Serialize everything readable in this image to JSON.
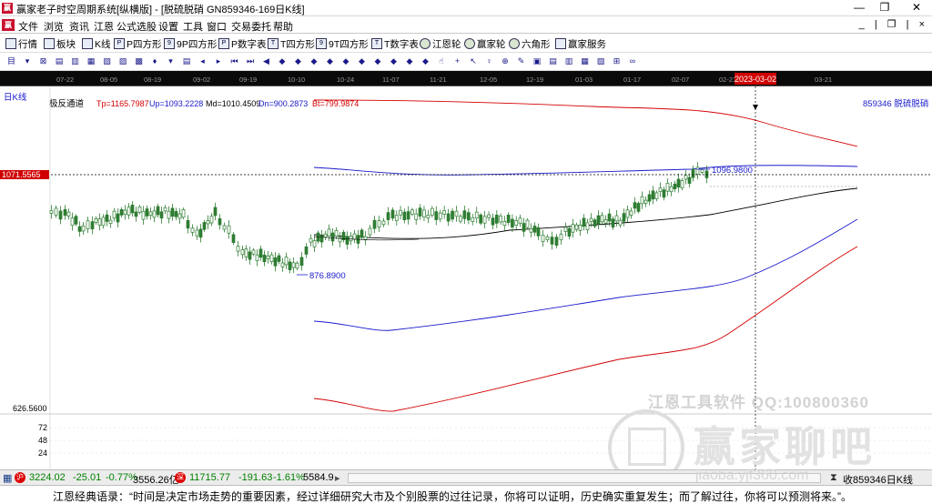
{
  "window": {
    "title": "赢家老子时空周期系统[纵横版] - [脱硫脱硝  GN859346-169日K线]",
    "minimize_glyph": "—",
    "maximize_glyph": "❐",
    "close_glyph": "✕"
  },
  "menu": {
    "items": [
      "文件",
      "浏览",
      "资讯",
      "江恩",
      "公式选股",
      "设置",
      "工具",
      "窗口",
      "交易委托",
      "帮助"
    ],
    "mdi_controls": "_ | ❐ | ×"
  },
  "toolbar1": {
    "items": [
      {
        "label": "行情",
        "icon": "grid-icon"
      },
      {
        "label": "板块",
        "icon": "blocks-icon"
      },
      {
        "label": "K线",
        "icon": "candle-icon"
      },
      {
        "label": "P四方形",
        "icon": "square-p-icon"
      },
      {
        "label": "9P四方形",
        "icon": "square-9p-icon"
      },
      {
        "label": "P数字表",
        "icon": "table-p-icon"
      },
      {
        "label": "T四方形",
        "icon": "square-t-icon"
      },
      {
        "label": "9T四方形",
        "icon": "square-9t-icon"
      },
      {
        "label": "T数字表",
        "icon": "table-t-icon"
      },
      {
        "label": "江恩轮",
        "icon": "wheel-icon"
      },
      {
        "label": "赢家轮",
        "icon": "wheel2-icon"
      },
      {
        "label": "六角形",
        "icon": "hexagon-icon"
      },
      {
        "label": "赢家服务",
        "icon": "service-icon"
      }
    ]
  },
  "toolbar2": {
    "glyphs": [
      "目",
      "▾",
      "⊠",
      "▤",
      "▥",
      "▦",
      "▧",
      "▨",
      "▩",
      "♦",
      "▾",
      "▤",
      "◂",
      "▸",
      "⏮",
      "⏭",
      "◀",
      "◆",
      "◆",
      "◆",
      "◆",
      "◆",
      "◆",
      "◆",
      "◆",
      "◆",
      "◆",
      "☝",
      "+",
      "↖",
      "♀",
      "⊕",
      "✎",
      "▣",
      "▤",
      "▥",
      "▦",
      "▧",
      "⊞",
      "∞"
    ]
  },
  "chart": {
    "period_label": "日K线",
    "indicator_name": "极反通道",
    "indicator_values": {
      "tp": "Tp=1165.7987",
      "up": "Up=1093.2228",
      "md": "Md=1010.4509",
      "dn": "Dn=900.2873",
      "bt": "Bt=799.9874"
    },
    "stock_tag": "859346  脱硫脱硝",
    "price_axis": {
      "crosshair_price": "1071.5565",
      "low_label": "626.5600"
    },
    "volume_axis": [
      "72",
      "48",
      "24"
    ],
    "annotations": {
      "high": "1096.9800",
      "low": "876.8900"
    },
    "date_ticks": [
      "07-22",
      "08-05",
      "08-19",
      "09-02",
      "09-19",
      "10-10",
      "10-24",
      "11-07",
      "11-21",
      "12-05",
      "12-19",
      "01-03",
      "01-17",
      "02-07",
      "02-21",
      "03-21"
    ],
    "crosshair_date": "2023-03-02",
    "colors": {
      "up_candle": "#2e7d32",
      "down_candle": "#2e7d32",
      "red_channel": "#d40000",
      "blue_channel": "#1a1acc",
      "mid_line": "#000000",
      "crosshair": "#000000"
    }
  },
  "status": {
    "sh_index": "3224.02",
    "sh_change": "-25.01",
    "sh_pct": "-0.77%",
    "sh_amount": "3556.26亿",
    "sz_index": "11715.77",
    "sz_change": "-191.63",
    "sz_pct": "-1.61%",
    "sz_amount": "5584.9",
    "right_info": "收859346日K线"
  },
  "quote": {
    "text": "江恩经典语录：“时间是决定市场走势的重要因素，经过详细研究大市及个别股票的过往记录，你将可以证明，历史确实重复发生；而了解过往，你将可以预测将来。”。"
  },
  "watermark": {
    "line1": "江恩工具软件  QQ:100800360",
    "line2": "赢家聊吧",
    "line3": "jiaoba.yjf360.com"
  }
}
